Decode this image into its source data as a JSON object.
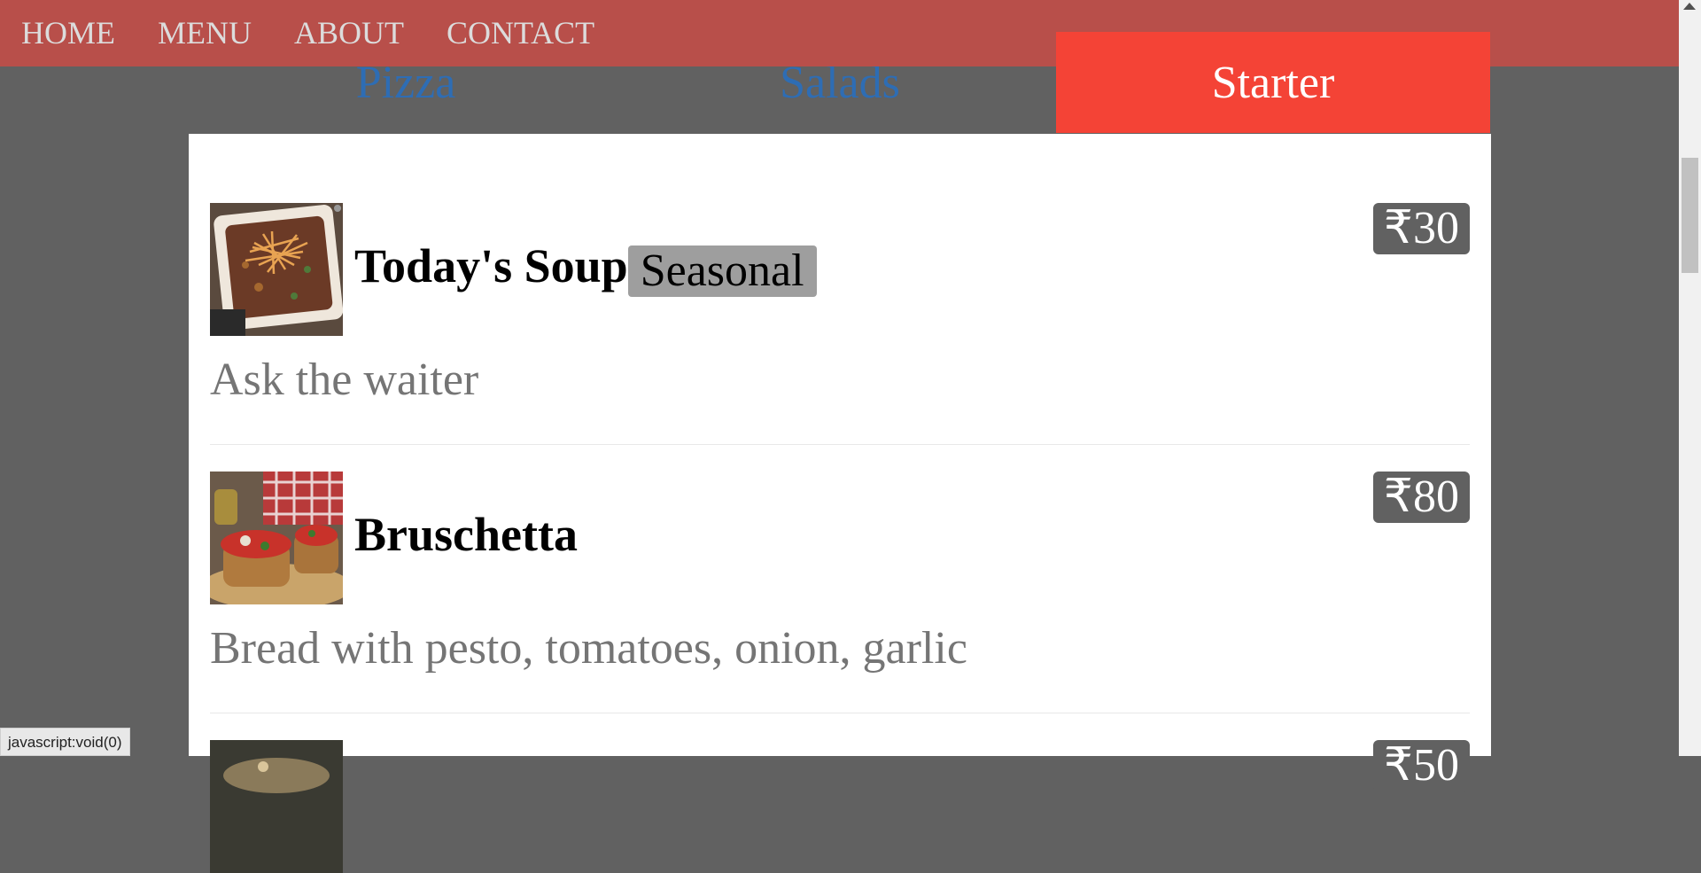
{
  "nav": {
    "items": [
      {
        "label": "HOME"
      },
      {
        "label": "MENU"
      },
      {
        "label": "ABOUT"
      },
      {
        "label": "CONTACT"
      }
    ]
  },
  "tabs": [
    {
      "label": "Pizza",
      "active": false
    },
    {
      "label": "Salads",
      "active": false
    },
    {
      "label": "Starter",
      "active": true
    }
  ],
  "items": [
    {
      "name": "Today's Soup",
      "badge": "Seasonal",
      "price": "₹30",
      "description": "Ask the waiter",
      "image_icon": "soup-bowl-photo"
    },
    {
      "name": "Bruschetta",
      "price": "₹80",
      "description": "Bread with pesto, tomatoes, onion, garlic",
      "image_icon": "bruschetta-photo"
    },
    {
      "price": "₹50",
      "image_icon": "food-photo"
    }
  ],
  "status_bar": {
    "text": "javascript:void(0)"
  },
  "colors": {
    "nav_bg": "#b84f4a",
    "active_tab": "#f44336",
    "inactive_tab_text": "#2e6db4",
    "page_bg": "#616161",
    "badge_bg": "#9e9e9e",
    "price_bg": "#616161"
  }
}
